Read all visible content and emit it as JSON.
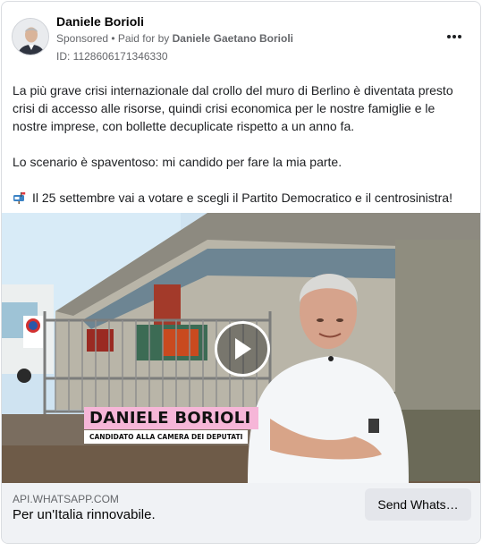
{
  "ad": {
    "page_name": "Daniele Borioli",
    "sponsored_label": "Sponsored",
    "paid_for_prefix": " • Paid for by ",
    "payer_name": "Daniele Gaetano Borioli",
    "ad_id": "ID: 1128606171346330",
    "more_icon": "more-horizontal-icon"
  },
  "body": {
    "paragraph_1": "La più grave crisi internazionale dal crollo del muro di Berlino è diventata presto crisi di accesso alle risorse, quindi crisi economica per le nostre famiglie e le nostre imprese, con bollette decuplicate rispetto a un anno fa.",
    "paragraph_2": "Lo scenario è spaventoso: mi candido per fare la mia parte.",
    "paragraph_3": "Il 25 settembre vai a votare e scegli il Partito Democratico e il centrosinistra!",
    "paragraph_3_icon": "mailbox-icon"
  },
  "media": {
    "type": "video",
    "overlay_name": "DANIELE BORIOLI",
    "overlay_role": "CANDIDATO ALLA CAMERA DEI DEPUTATI",
    "overlay_name_bg": "#f6b6d8",
    "play_icon": "play-icon"
  },
  "footer": {
    "domain": "API.WHATSAPP.COM",
    "headline": "Per un'Italia rinnovabile.",
    "cta_label": "Send Whats…"
  }
}
